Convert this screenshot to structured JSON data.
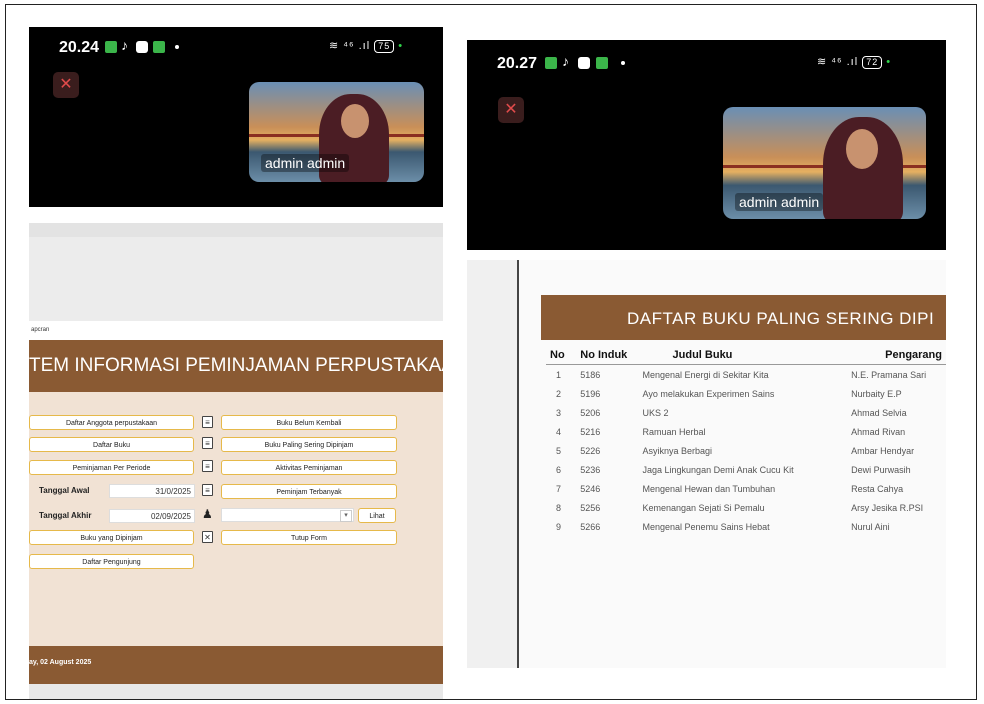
{
  "left": {
    "status_time": "20.24",
    "battery": "75",
    "video_name": "admin admin",
    "breadcrumb": "apcran",
    "form_title": "TEM INFORMASI PEMINJAMAN PERPUSTAKAAN",
    "left_buttons": [
      "Daftar Anggota perpustakaan",
      "Daftar Buku",
      "Peminjaman Per Periode"
    ],
    "tanggal_awal_label": "Tanggal Awal",
    "tanggal_awal_value": "31/0/2025",
    "tanggal_akhir_label": "Tanggal Akhir",
    "tanggal_akhir_value": "02/09/2025",
    "buku_dipinjam": "Buku yang Dipinjam",
    "daftar_pengunjung": "Daftar Pengunjung",
    "right_buttons": [
      "Buku Belum Kembali",
      "Buku Paling Sering Dipinjam",
      "Aktivitas Peminjaman",
      "Peminjam Terbanyak"
    ],
    "lihat": "Lihat",
    "tutup": "Tutup Form",
    "footer_date": "ay, 02 August 2025"
  },
  "right": {
    "status_time": "20.27",
    "battery": "72",
    "video_name": "admin admin",
    "report_title": "DAFTAR BUKU PALING SERING DIPI",
    "columns": [
      "No",
      "No Induk",
      "Judul Buku",
      "Pengarang"
    ],
    "rows": [
      [
        "1",
        "5186",
        "Mengenal Energi di Sekitar Kita",
        "N.E. Pramana Sari"
      ],
      [
        "2",
        "5196",
        "Ayo melakukan Experimen Sains",
        "Nurbaity E.P"
      ],
      [
        "3",
        "5206",
        "UKS 2",
        "Ahmad Selvia"
      ],
      [
        "4",
        "5216",
        "Ramuan Herbal",
        "Ahmad Rivan"
      ],
      [
        "5",
        "5226",
        "Asyiknya Berbagi",
        "Ambar Hendyar"
      ],
      [
        "6",
        "5236",
        "Jaga Lingkungan Demi Anak Cucu Kit",
        "Dewi Purwasih"
      ],
      [
        "7",
        "5246",
        "Mengenal Hewan dan Tumbuhan",
        "Resta Cahya"
      ],
      [
        "8",
        "5256",
        "Kemenangan Sejati Si Pemalu",
        "Arsy Jesika R.PSI"
      ],
      [
        "9",
        "5266",
        "Mengenal Penemu Sains Hebat",
        "Nurul Aini"
      ]
    ]
  },
  "colors": {
    "brown": "#8a5a33",
    "beige": "#f1e2d4",
    "gold_border": "#e6b94a"
  }
}
